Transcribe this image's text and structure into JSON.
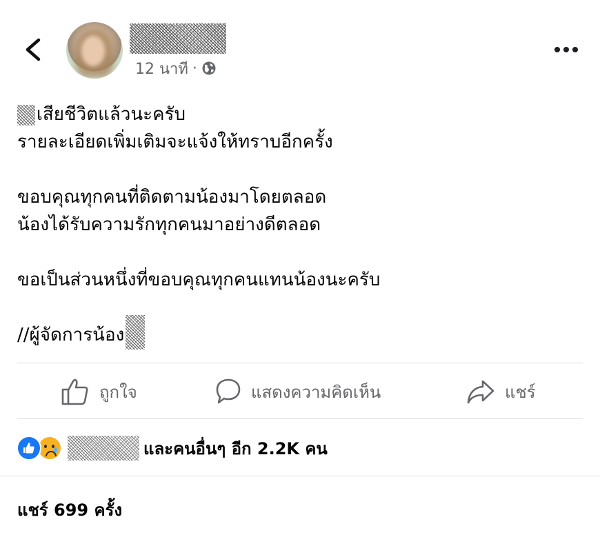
{
  "header": {
    "back_icon": "chevron-left-icon",
    "time_ago": "12 นาที",
    "separator": "·",
    "privacy_icon": "globe-icon",
    "more_icon": "more-horizontal-icon"
  },
  "post": {
    "lines": [
      "เสียชีวิตแล้วนะครับ",
      "รายละเอียดเพิ่มเติมจะแจ้งให้ทราบอีกครั้ง",
      "ขอบคุณทุกคนที่ติดตามน้องมาโดยตลอด",
      "น้องได้รับความรักทุกคนมาอย่างดีตลอด",
      "ขอเป็นส่วนหนึ่งที่ขอบคุณทุกคนแทนน้องนะครับ",
      "//ผู้จัดการน้อง"
    ]
  },
  "actions": {
    "like_label": "ถูกใจ",
    "comment_label": "แสดงความคิดเห็น",
    "share_label": "แชร์"
  },
  "reactions": {
    "summary": "และคนอื่นๆ อีก 2.2K คน",
    "types": [
      "like",
      "sad"
    ]
  },
  "shares": {
    "label": "แชร์ 699 ครั้ง"
  },
  "colors": {
    "secondary_text": "#65676b",
    "primary_text": "#050505",
    "like_blue": "#1877f2",
    "sad_yellow": "#f7b125",
    "divider": "#dadde1"
  }
}
